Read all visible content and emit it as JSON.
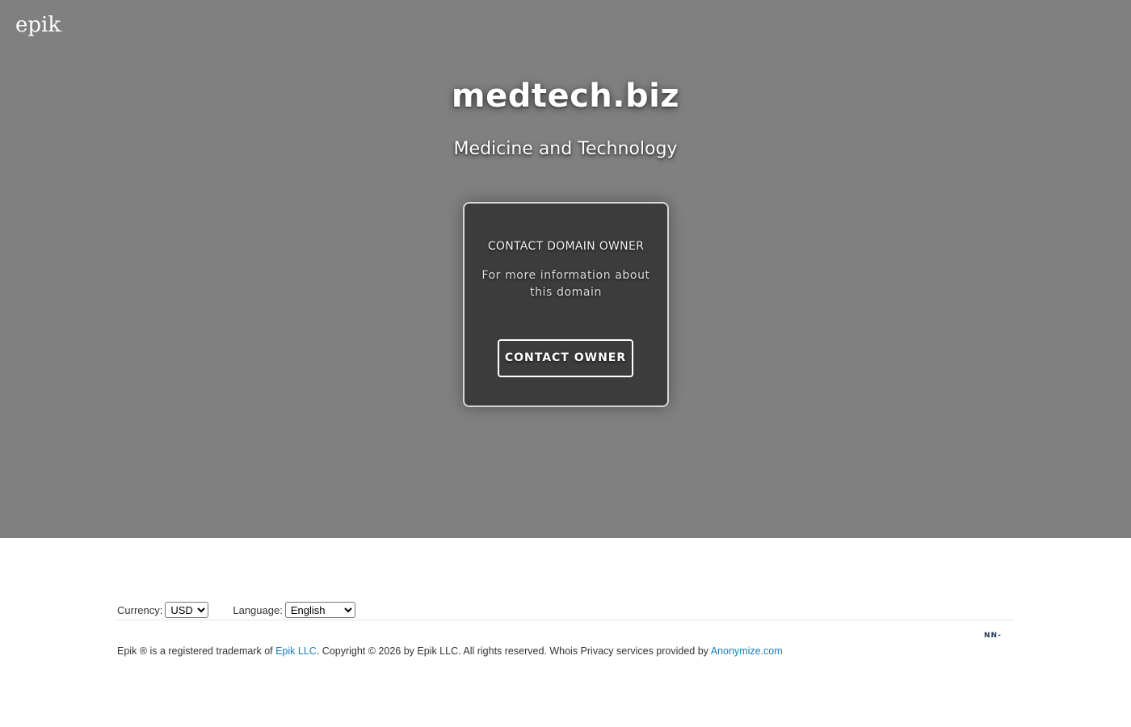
{
  "header": {
    "logo_text": "epik",
    "logo_mark": "."
  },
  "hero": {
    "domain": "medtech.biz",
    "tagline": "Medicine and Technology"
  },
  "contact_card": {
    "heading": "CONTACT DOMAIN OWNER",
    "text": "For more information about this domain",
    "button_label": "CONTACT OWNER"
  },
  "footer": {
    "currency_label": "Currency:",
    "currency_value": "USD",
    "language_label": "Language:",
    "language_value": "English",
    "copy_prefix": "Epik ® is a registered trademark of ",
    "epik_link": "Epik LLC",
    "copy_middle": ". Copyright © 2026 by Epik LLC. All rights reserved. Whois Privacy services provided by ",
    "anonymize_link": "Anonymize.com",
    "partner_logo_text": "NN-"
  },
  "colors": {
    "hero_bg": "#808080",
    "card_bg": "#3c3c3c",
    "link": "#1a7cc1"
  }
}
